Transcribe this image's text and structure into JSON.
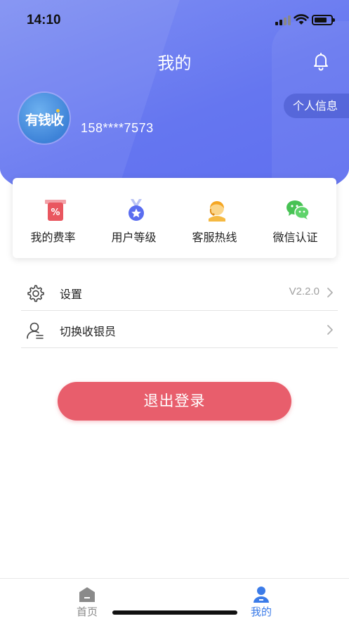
{
  "status_bar": {
    "time": "14:10"
  },
  "header": {
    "title": "我的",
    "bell_icon": "bell-icon"
  },
  "profile": {
    "button_label": "个人信息",
    "avatar_text": "有钱收",
    "phone": "158****7573"
  },
  "quick_actions": [
    {
      "label": "我的费率",
      "icon": "rate-percent-icon"
    },
    {
      "label": "用户等级",
      "icon": "medal-icon"
    },
    {
      "label": "客服热线",
      "icon": "customer-service-icon"
    },
    {
      "label": "微信认证",
      "icon": "wechat-icon"
    }
  ],
  "menu": {
    "settings": {
      "label": "设置",
      "value": "V2.2.0",
      "icon": "gear-icon"
    },
    "switch_cashier": {
      "label": "切换收银员",
      "icon": "user-switch-icon"
    }
  },
  "logout": {
    "label": "退出登录"
  },
  "tabbar": {
    "tabs": [
      {
        "label": "首页",
        "icon": "home-icon",
        "active": false
      },
      {
        "label": "我的",
        "icon": "user-icon",
        "active": true
      }
    ],
    "active_color": "#3b7be8",
    "inactive_color": "#888888"
  },
  "colors": {
    "header": "#6576f0",
    "logout_button": "#e85e6c"
  }
}
